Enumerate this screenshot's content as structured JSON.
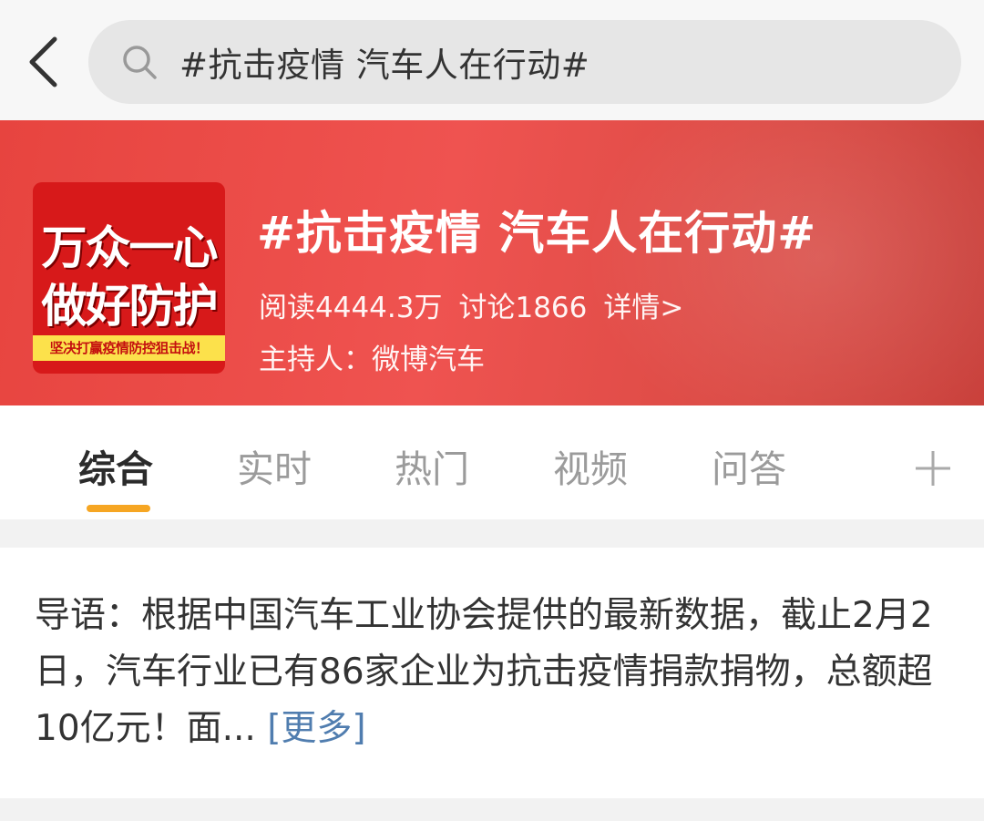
{
  "search": {
    "query": "#抗击疫情 汽车人在行动#"
  },
  "topic": {
    "title": "#抗击疫情 汽车人在行动#",
    "reads_label": "阅读4444.3万",
    "discussions_label": "讨论1866",
    "detail_label": "详情>",
    "host_label": "主持人：微博汽车",
    "image": {
      "line1": "万众一心",
      "line2": "做好防护",
      "strip": "坚决打赢疫情防控狙击战！"
    }
  },
  "tabs": [
    {
      "label": "综合",
      "active": true
    },
    {
      "label": "实时",
      "active": false
    },
    {
      "label": "热门",
      "active": false
    },
    {
      "label": "视频",
      "active": false
    },
    {
      "label": "问答",
      "active": false
    }
  ],
  "intro": {
    "text": "导语：根据中国汽车工业协会提供的最新数据，截止2月2日，汽车行业已有86家企业为抗击疫情捐款捐物，总额超10亿元！面... ",
    "more_label": "[更多]"
  },
  "colors": {
    "banner": "#e7443f",
    "tab_indicator": "#f6a623",
    "link": "#507daf"
  },
  "icons": [
    "back-arrow-icon",
    "search-icon",
    "plus-icon"
  ]
}
